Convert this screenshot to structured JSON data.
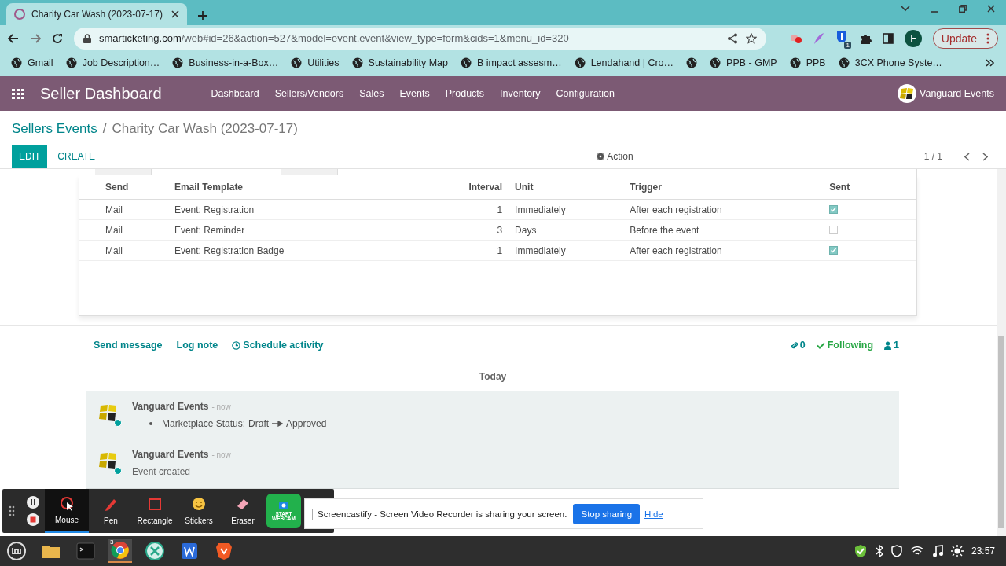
{
  "browser": {
    "tabs": [
      {
        "title": "Charity Car Wash (2023-07-17)",
        "selected": true
      }
    ],
    "address": {
      "domain": "smarticketing.com",
      "path": "/web#id=26&action=527&model=event.event&view_type=form&cids=1&menu_id=320"
    },
    "extension_badge": "1",
    "profile_initial": "F",
    "update_label": "Update",
    "bookmarks": [
      {
        "kind": "link",
        "label": "Gmail"
      },
      {
        "kind": "link",
        "label": "Job Description…"
      },
      {
        "kind": "link",
        "label": "Business-in-a-Box…"
      },
      {
        "kind": "link",
        "label": "Utilities"
      },
      {
        "kind": "link",
        "label": "Sustainability Map"
      },
      {
        "kind": "link",
        "label": "B impact assesm…"
      },
      {
        "kind": "link",
        "label": "Lendahand | Cro…"
      },
      {
        "kind": "icon"
      },
      {
        "kind": "link",
        "label": "PPB - GMP"
      },
      {
        "kind": "link",
        "label": "PPB"
      },
      {
        "kind": "link",
        "label": "3CX Phone Syste…"
      }
    ]
  },
  "app": {
    "title": "Seller Dashboard",
    "menu": [
      "Dashboard",
      "Sellers/Vendors",
      "Sales",
      "Events",
      "Products",
      "Inventory",
      "Configuration"
    ],
    "user": "Vanguard Events"
  },
  "breadcrumb": [
    "Sellers Events",
    "Charity Car Wash (2023-07-17)"
  ],
  "breadcrumb_separator": "/",
  "form_tabs": [
    {
      "selected": false
    },
    {
      "selected": true
    },
    {
      "selected": false
    }
  ],
  "buttons": {
    "edit": "EDIT",
    "create": "CREATE",
    "action": "Action",
    "pager": "1 / 1"
  },
  "table": {
    "columns": [
      "Send",
      "Email Template",
      "Interval",
      "Unit",
      "Trigger",
      "Sent"
    ],
    "rows": [
      {
        "send": "Mail",
        "template": "Event: Registration",
        "interval": "1",
        "unit": "Immediately",
        "trigger": "After each registration",
        "sent": true
      },
      {
        "send": "Mail",
        "template": "Event: Reminder",
        "interval": "3",
        "unit": "Days",
        "trigger": "Before the event",
        "sent": false
      },
      {
        "send": "Mail",
        "template": "Event: Registration Badge",
        "interval": "1",
        "unit": "Immediately",
        "trigger": "After each registration",
        "sent": true
      }
    ]
  },
  "chatter": {
    "actions": [
      "Send message",
      "Log note",
      "Schedule activity"
    ],
    "attachments": "0",
    "following": "Following",
    "followers": "1",
    "date_divider": "Today",
    "messages": [
      {
        "author": "Vanguard Events",
        "time": "- now",
        "tracking": [
          {
            "field": "Marketplace Status:",
            "old": "Draft",
            "new": "Approved"
          }
        ]
      },
      {
        "author": "Vanguard Events",
        "time": "- now",
        "body": "Event created"
      }
    ]
  },
  "recorder": {
    "tools": [
      {
        "label": "Mouse",
        "selected": true
      },
      {
        "label": "Pen",
        "selected": false
      },
      {
        "label": "Rectangle",
        "selected": false
      },
      {
        "label": "Stickers",
        "selected": false
      },
      {
        "label": "Eraser",
        "selected": false
      }
    ],
    "webcam": "START WEBCAM"
  },
  "share_bar": {
    "message": "Screencastify - Screen Video Recorder is sharing your screen.",
    "stop": "Stop sharing",
    "hide": "Hide"
  },
  "taskbar": {
    "chrome_badge": "3",
    "clock": "23:57"
  }
}
